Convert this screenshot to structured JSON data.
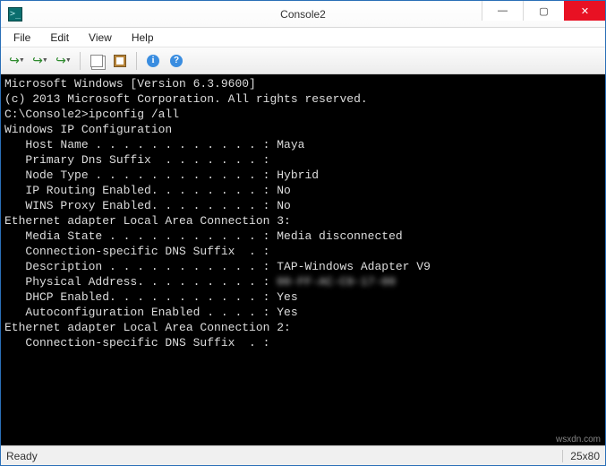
{
  "window": {
    "title": "Console2"
  },
  "menubar": {
    "items": [
      "File",
      "Edit",
      "View",
      "Help"
    ]
  },
  "toolbar": {
    "icons": [
      "new-tab",
      "new-tab-2",
      "new-tab-3",
      "sep",
      "copy",
      "paste",
      "sep",
      "info",
      "help"
    ]
  },
  "terminal": {
    "lines": [
      "Microsoft Windows [Version 6.3.9600]",
      "(c) 2013 Microsoft Corporation. All rights reserved.",
      "",
      "C:\\Console2>ipconfig /all",
      "",
      "Windows IP Configuration",
      "",
      "   Host Name . . . . . . . . . . . . : Maya",
      "   Primary Dns Suffix  . . . . . . . :",
      "   Node Type . . . . . . . . . . . . : Hybrid",
      "   IP Routing Enabled. . . . . . . . : No",
      "   WINS Proxy Enabled. . . . . . . . : No",
      "",
      "Ethernet adapter Local Area Connection 3:",
      "",
      "   Media State . . . . . . . . . . . : Media disconnected",
      "   Connection-specific DNS Suffix  . :",
      "   Description . . . . . . . . . . . : TAP-Windows Adapter V9",
      "   Physical Address. . . . . . . . . : ",
      "   DHCP Enabled. . . . . . . . . . . : Yes",
      "   Autoconfiguration Enabled . . . . : Yes",
      "",
      "Ethernet adapter Local Area Connection 2:",
      "",
      "   Connection-specific DNS Suffix  . :"
    ],
    "blurred_mac": "00-FF-AC-C9-17-00"
  },
  "statusbar": {
    "left": "Ready",
    "right": "25x80"
  },
  "watermark": "wsxdn.com"
}
